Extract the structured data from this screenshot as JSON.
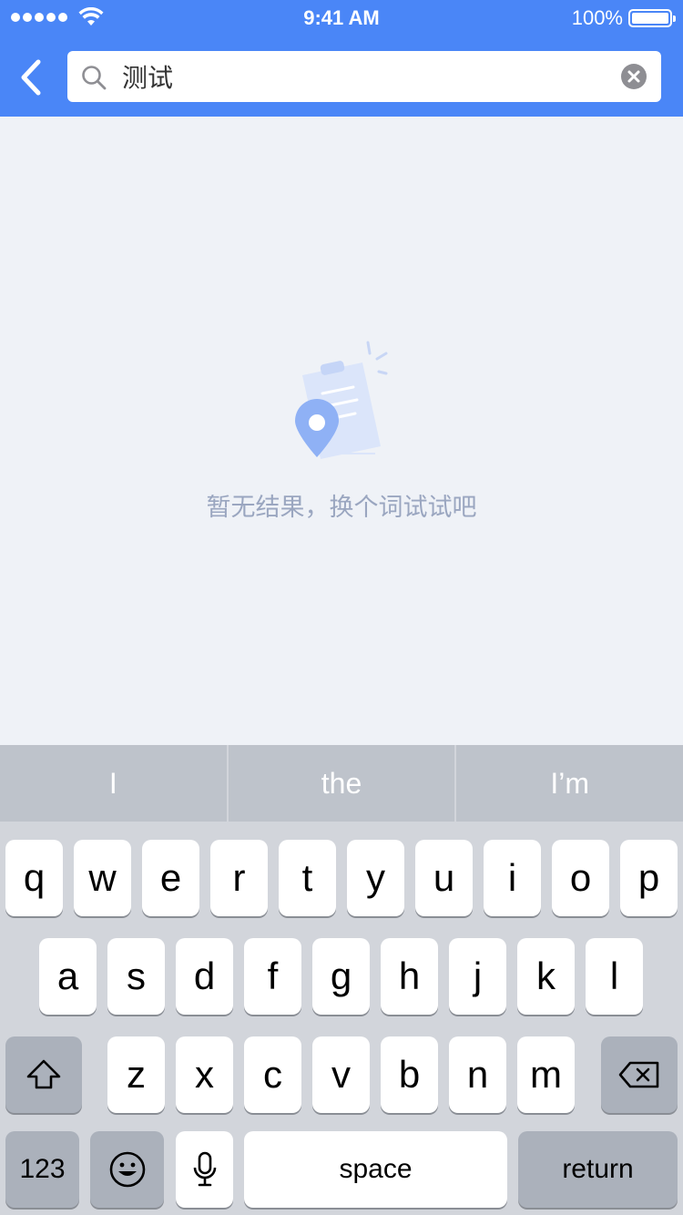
{
  "status_bar": {
    "time": "9:41 AM",
    "battery": "100%"
  },
  "search": {
    "value": "测试"
  },
  "empty_state": {
    "message": "暂无结果，换个词试试吧"
  },
  "keyboard": {
    "suggestions": [
      "I",
      "the",
      "I’m"
    ],
    "row1": [
      "q",
      "w",
      "e",
      "r",
      "t",
      "y",
      "u",
      "i",
      "o",
      "p"
    ],
    "row2": [
      "a",
      "s",
      "d",
      "f",
      "g",
      "h",
      "j",
      "k",
      "l"
    ],
    "row3": [
      "z",
      "x",
      "c",
      "v",
      "b",
      "n",
      "m"
    ],
    "numbers_label": "123",
    "space_label": "space",
    "return_label": "return"
  },
  "colors": {
    "header": "#4a86f7",
    "background": "#eff2f7",
    "empty_text": "#9aa6c0",
    "keyboard": "#d2d5db"
  }
}
